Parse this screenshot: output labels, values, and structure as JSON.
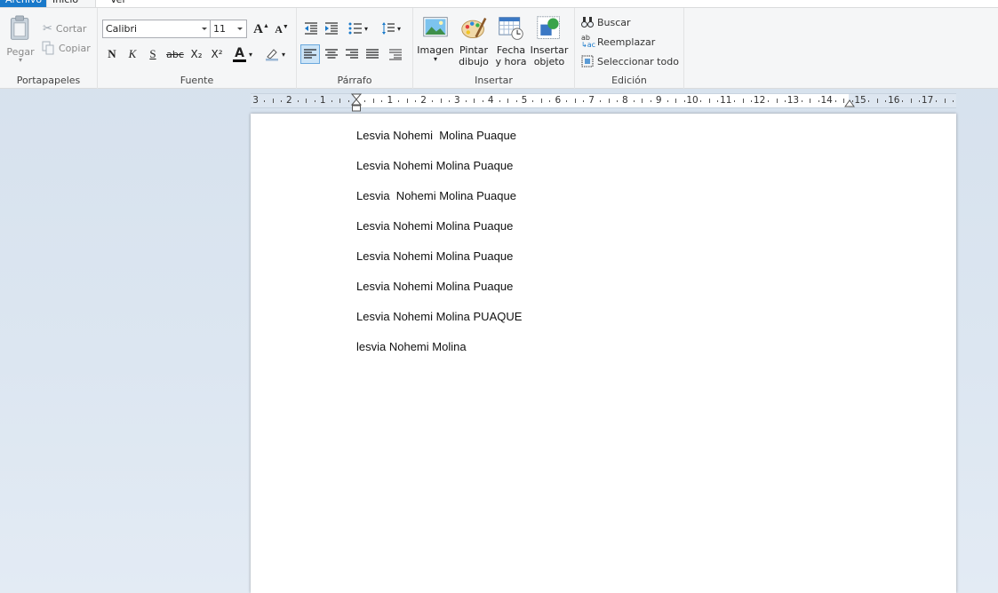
{
  "tabs": {
    "file": "Archivo",
    "home": "Inicio",
    "view": "Ver"
  },
  "ribbon": {
    "clipboard": {
      "label": "Portapapeles",
      "paste": "Pegar",
      "cut": "Cortar",
      "copy": "Copiar"
    },
    "font": {
      "label": "Fuente",
      "family": "Calibri",
      "size": "11",
      "bold": "N",
      "italic": "K",
      "underline": "S",
      "strike": "abc",
      "subscript": "X₂",
      "superscript": "X²",
      "font_color": "A"
    },
    "paragraph": {
      "label": "Párrafo"
    },
    "insert": {
      "label": "Insertar",
      "image": "Imagen",
      "paint_line1": "Pintar",
      "paint_line2": "dibujo",
      "datetime_line1": "Fecha",
      "datetime_line2": "y hora",
      "object_line1": "Insertar",
      "object_line2": "objeto"
    },
    "editing": {
      "label": "Edición",
      "find": "Buscar",
      "replace": "Reemplazar",
      "select_all": "Seleccionar todo"
    }
  },
  "ruler": {
    "numbers": [
      "3",
      "2",
      "1",
      "1",
      "2",
      "3",
      "4",
      "5",
      "6",
      "7",
      "8",
      "9",
      "10",
      "11",
      "12",
      "13",
      "14",
      "15",
      "16",
      "17"
    ]
  },
  "document": {
    "lines": [
      "Lesvia Nohemi  Molina Puaque",
      "Lesvia Nohemi Molina Puaque",
      "Lesvia  Nohemi Molina Puaque",
      "Lesvia Nohemi Molina Puaque",
      "Lesvia Nohemi Molina Puaque",
      "Lesvia Nohemi Molina Puaque",
      "Lesvia Nohemi Molina PUAQUE",
      "lesvia Nohemi Molina"
    ]
  },
  "colors": {
    "accent": "#1979ca",
    "background": "#dce6f1",
    "ribbon": "#f5f6f7"
  }
}
